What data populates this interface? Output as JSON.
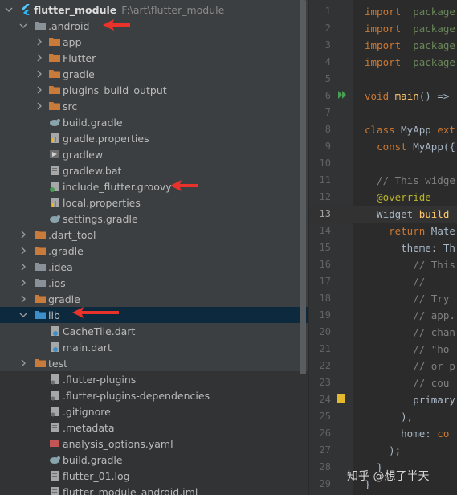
{
  "project": {
    "name": "flutter_module",
    "path": "F:\\art\\flutter_module"
  },
  "tree": [
    {
      "label": "flutter_module",
      "type": "root",
      "expanded": true,
      "indent": 0
    },
    {
      "label": ".android",
      "type": "folder-gray",
      "expanded": true,
      "indent": 1
    },
    {
      "label": "app",
      "type": "folder",
      "expanded": false,
      "indent": 2
    },
    {
      "label": "Flutter",
      "type": "folder",
      "expanded": false,
      "indent": 2
    },
    {
      "label": "gradle",
      "type": "folder",
      "expanded": false,
      "indent": 2
    },
    {
      "label": "plugins_build_output",
      "type": "folder",
      "expanded": false,
      "indent": 2
    },
    {
      "label": "src",
      "type": "folder",
      "expanded": false,
      "indent": 2
    },
    {
      "label": "build.gradle",
      "type": "gradle-file",
      "indent": 3
    },
    {
      "label": "gradle.properties",
      "type": "properties-file",
      "indent": 3
    },
    {
      "label": "gradlew",
      "type": "exec-file",
      "indent": 3
    },
    {
      "label": "gradlew.bat",
      "type": "text-file",
      "indent": 3
    },
    {
      "label": "include_flutter.groovy",
      "type": "groovy-file",
      "indent": 3
    },
    {
      "label": "local.properties",
      "type": "properties-file",
      "indent": 3
    },
    {
      "label": "settings.gradle",
      "type": "gradle-file",
      "indent": 3
    },
    {
      "label": ".dart_tool",
      "type": "folder",
      "expanded": false,
      "indent": 1
    },
    {
      "label": ".gradle",
      "type": "folder",
      "expanded": false,
      "indent": 1
    },
    {
      "label": ".idea",
      "type": "folder-gray",
      "expanded": false,
      "indent": 1
    },
    {
      "label": ".ios",
      "type": "folder-gray",
      "expanded": false,
      "indent": 1
    },
    {
      "label": "gradle",
      "type": "folder",
      "expanded": false,
      "indent": 1
    },
    {
      "label": "lib",
      "type": "folder-blue",
      "expanded": true,
      "indent": 1
    },
    {
      "label": "CacheTile.dart",
      "type": "dart-file",
      "indent": 3
    },
    {
      "label": "main.dart",
      "type": "dart-file",
      "indent": 3
    },
    {
      "label": "test",
      "type": "folder-test",
      "expanded": false,
      "indent": 1
    },
    {
      "label": ".flutter-plugins",
      "type": "config-file",
      "indent": 2
    },
    {
      "label": ".flutter-plugins-dependencies",
      "type": "config-file",
      "indent": 2
    },
    {
      "label": ".gitignore",
      "type": "config-file",
      "indent": 2
    },
    {
      "label": ".metadata",
      "type": "text-file",
      "indent": 2
    },
    {
      "label": "analysis_options.yaml",
      "type": "yaml-file",
      "indent": 2
    },
    {
      "label": "build.gradle",
      "type": "gradle-file",
      "indent": 2
    },
    {
      "label": "flutter_01.log",
      "type": "text-file",
      "indent": 2
    },
    {
      "label": "flutter_module_android.iml",
      "type": "text-file",
      "indent": 2
    }
  ],
  "editor": {
    "current_line": 13,
    "lines": [
      {
        "n": "1",
        "segs": [
          [
            "kw",
            "import "
          ],
          [
            "str",
            "'package"
          ]
        ]
      },
      {
        "n": "2",
        "segs": [
          [
            "kw",
            "import "
          ],
          [
            "str",
            "'package"
          ]
        ]
      },
      {
        "n": "3",
        "segs": [
          [
            "kw",
            "import "
          ],
          [
            "str",
            "'package"
          ]
        ]
      },
      {
        "n": "4",
        "segs": [
          [
            "kw",
            "import "
          ],
          [
            "str",
            "'package"
          ]
        ]
      },
      {
        "n": "5",
        "segs": []
      },
      {
        "n": "6",
        "segs": [
          [
            "kw",
            "void "
          ],
          [
            "fn",
            "main"
          ],
          [
            "t",
            "() =>"
          ]
        ]
      },
      {
        "n": "7",
        "segs": []
      },
      {
        "n": "8",
        "segs": [
          [
            "kw",
            "class "
          ],
          [
            "t",
            "MyApp "
          ],
          [
            "kw",
            "ext"
          ]
        ]
      },
      {
        "n": "9",
        "segs": [
          [
            "t",
            "  "
          ],
          [
            "kw",
            "const "
          ],
          [
            "t",
            "MyApp({"
          ]
        ]
      },
      {
        "n": "10",
        "segs": []
      },
      {
        "n": "11",
        "segs": [
          [
            "cmt",
            "  // This widge"
          ]
        ]
      },
      {
        "n": "12",
        "segs": [
          [
            "ann",
            "  @override"
          ]
        ]
      },
      {
        "n": "13",
        "segs": [
          [
            "t",
            "  Widget "
          ],
          [
            "fn",
            "build"
          ]
        ]
      },
      {
        "n": "14",
        "segs": [
          [
            "t",
            "    "
          ],
          [
            "kw",
            "return "
          ],
          [
            "t",
            "Mate"
          ]
        ]
      },
      {
        "n": "15",
        "segs": [
          [
            "t",
            "      theme: Th"
          ]
        ]
      },
      {
        "n": "16",
        "segs": [
          [
            "cmt",
            "        // This"
          ]
        ]
      },
      {
        "n": "17",
        "segs": [
          [
            "cmt",
            "        //"
          ]
        ]
      },
      {
        "n": "18",
        "segs": [
          [
            "cmt",
            "        // Try"
          ]
        ]
      },
      {
        "n": "19",
        "segs": [
          [
            "cmt",
            "        // app."
          ]
        ]
      },
      {
        "n": "20",
        "segs": [
          [
            "cmt",
            "        // chan"
          ]
        ]
      },
      {
        "n": "21",
        "segs": [
          [
            "cmt",
            "        // \"ho"
          ]
        ]
      },
      {
        "n": "22",
        "segs": [
          [
            "cmt",
            "        // or p"
          ]
        ]
      },
      {
        "n": "23",
        "segs": [
          [
            "cmt",
            "        // cou"
          ]
        ]
      },
      {
        "n": "24",
        "segs": [
          [
            "t",
            "        primary"
          ]
        ]
      },
      {
        "n": "25",
        "segs": [
          [
            "t",
            "      ),"
          ]
        ]
      },
      {
        "n": "26",
        "segs": [
          [
            "t",
            "      home: "
          ],
          [
            "kw",
            "co"
          ]
        ]
      },
      {
        "n": "27",
        "segs": [
          [
            "t",
            "    );"
          ]
        ]
      },
      {
        "n": "28",
        "segs": [
          [
            "t",
            "  }"
          ]
        ]
      },
      {
        "n": "29",
        "segs": [
          [
            "t",
            "}"
          ]
        ]
      }
    ]
  },
  "watermark": "知乎 @想了半天",
  "colors": {
    "annotation_arrow": "#e8322a",
    "folder": "#c97b3c",
    "folder_blue": "#3d8ec9",
    "folder_gray": "#8a9199"
  }
}
